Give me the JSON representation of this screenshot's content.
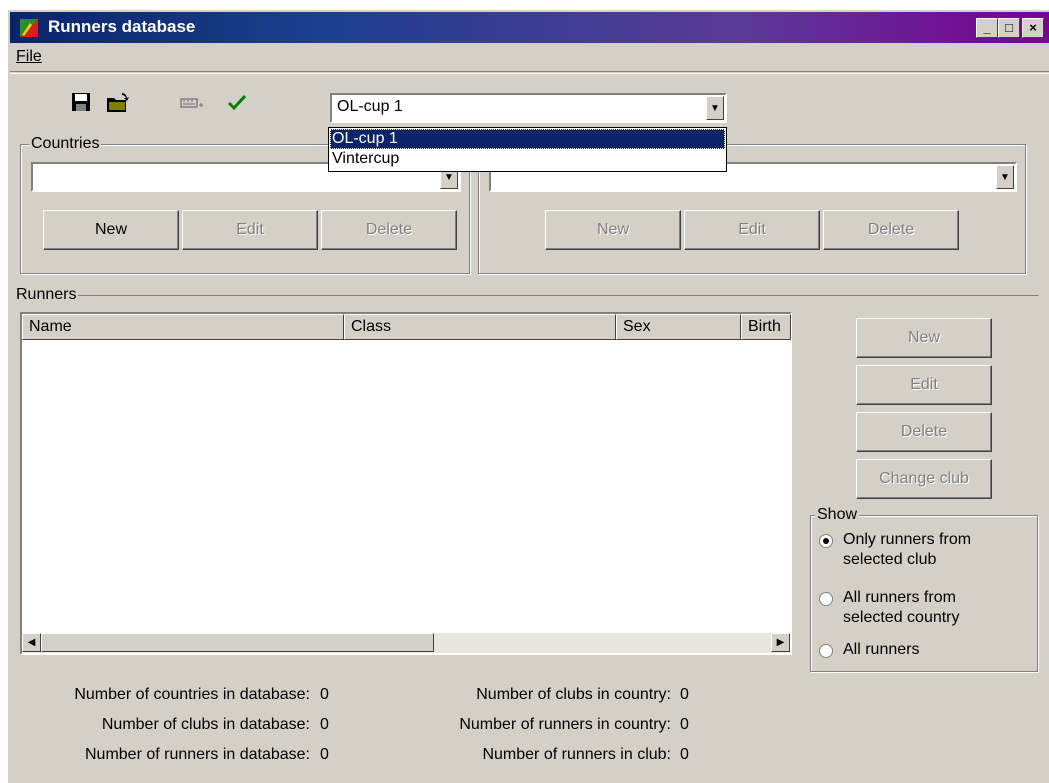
{
  "window": {
    "title": "Runners database",
    "controls": {
      "minimize": "_",
      "maximize": "□",
      "close": "×"
    }
  },
  "menu": {
    "file": "File"
  },
  "toolbar": {
    "icons": [
      "save-icon",
      "open-icon",
      "keyboard-icon",
      "check-icon"
    ],
    "cup_select": {
      "value": "OL-cup 1",
      "options": [
        "OL-cup 1",
        "Vintercup"
      ],
      "highlighted": "OL-cup 1"
    }
  },
  "countries": {
    "label": "Countries",
    "value": "",
    "buttons": {
      "new": "New",
      "edit": "Edit",
      "delete": "Delete"
    }
  },
  "clubs": {
    "value": "",
    "buttons": {
      "new": "New",
      "edit": "Edit",
      "delete": "Delete"
    }
  },
  "runners": {
    "label": "Runners",
    "columns": [
      "Name",
      "Class",
      "Sex",
      "Birth"
    ],
    "rows": [],
    "buttons": {
      "new": "New",
      "edit": "Edit",
      "delete": "Delete",
      "change_club": "Change club"
    }
  },
  "show": {
    "label": "Show",
    "options": [
      {
        "line1": "Only runners from",
        "line2": "selected club",
        "checked": true
      },
      {
        "line1": "All runners from",
        "line2": "selected country",
        "checked": false
      },
      {
        "line1": "All runners",
        "line2": "",
        "checked": false
      }
    ]
  },
  "stats": {
    "countries_in_db": {
      "label": "Number of countries in database:",
      "value": "0"
    },
    "clubs_in_db": {
      "label": "Number of clubs in database:",
      "value": "0"
    },
    "runners_in_db": {
      "label": "Number of runners in database:",
      "value": "0"
    },
    "clubs_in_country": {
      "label": "Number of clubs in country:",
      "value": "0"
    },
    "runners_in_country": {
      "label": "Number of runners in country:",
      "value": "0"
    },
    "runners_in_club": {
      "label": "Number of runners in club:",
      "value": "0"
    }
  },
  "colors": {
    "titlebar_start": "#0a246a",
    "titlebar_end": "#7a0090",
    "face": "#d4d0c8",
    "selection": "#0a246a"
  }
}
